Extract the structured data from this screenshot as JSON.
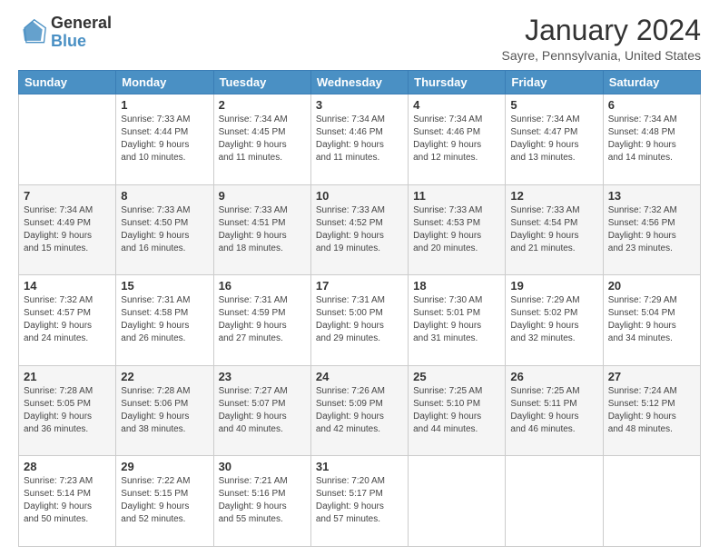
{
  "logo": {
    "line1": "General",
    "line2": "Blue"
  },
  "title": "January 2024",
  "subtitle": "Sayre, Pennsylvania, United States",
  "days_header": [
    "Sunday",
    "Monday",
    "Tuesday",
    "Wednesday",
    "Thursday",
    "Friday",
    "Saturday"
  ],
  "weeks": [
    [
      {
        "day": "",
        "info": ""
      },
      {
        "day": "1",
        "info": "Sunrise: 7:33 AM\nSunset: 4:44 PM\nDaylight: 9 hours\nand 10 minutes."
      },
      {
        "day": "2",
        "info": "Sunrise: 7:34 AM\nSunset: 4:45 PM\nDaylight: 9 hours\nand 11 minutes."
      },
      {
        "day": "3",
        "info": "Sunrise: 7:34 AM\nSunset: 4:46 PM\nDaylight: 9 hours\nand 11 minutes."
      },
      {
        "day": "4",
        "info": "Sunrise: 7:34 AM\nSunset: 4:46 PM\nDaylight: 9 hours\nand 12 minutes."
      },
      {
        "day": "5",
        "info": "Sunrise: 7:34 AM\nSunset: 4:47 PM\nDaylight: 9 hours\nand 13 minutes."
      },
      {
        "day": "6",
        "info": "Sunrise: 7:34 AM\nSunset: 4:48 PM\nDaylight: 9 hours\nand 14 minutes."
      }
    ],
    [
      {
        "day": "7",
        "info": "Sunrise: 7:34 AM\nSunset: 4:49 PM\nDaylight: 9 hours\nand 15 minutes."
      },
      {
        "day": "8",
        "info": "Sunrise: 7:33 AM\nSunset: 4:50 PM\nDaylight: 9 hours\nand 16 minutes."
      },
      {
        "day": "9",
        "info": "Sunrise: 7:33 AM\nSunset: 4:51 PM\nDaylight: 9 hours\nand 18 minutes."
      },
      {
        "day": "10",
        "info": "Sunrise: 7:33 AM\nSunset: 4:52 PM\nDaylight: 9 hours\nand 19 minutes."
      },
      {
        "day": "11",
        "info": "Sunrise: 7:33 AM\nSunset: 4:53 PM\nDaylight: 9 hours\nand 20 minutes."
      },
      {
        "day": "12",
        "info": "Sunrise: 7:33 AM\nSunset: 4:54 PM\nDaylight: 9 hours\nand 21 minutes."
      },
      {
        "day": "13",
        "info": "Sunrise: 7:32 AM\nSunset: 4:56 PM\nDaylight: 9 hours\nand 23 minutes."
      }
    ],
    [
      {
        "day": "14",
        "info": "Sunrise: 7:32 AM\nSunset: 4:57 PM\nDaylight: 9 hours\nand 24 minutes."
      },
      {
        "day": "15",
        "info": "Sunrise: 7:31 AM\nSunset: 4:58 PM\nDaylight: 9 hours\nand 26 minutes."
      },
      {
        "day": "16",
        "info": "Sunrise: 7:31 AM\nSunset: 4:59 PM\nDaylight: 9 hours\nand 27 minutes."
      },
      {
        "day": "17",
        "info": "Sunrise: 7:31 AM\nSunset: 5:00 PM\nDaylight: 9 hours\nand 29 minutes."
      },
      {
        "day": "18",
        "info": "Sunrise: 7:30 AM\nSunset: 5:01 PM\nDaylight: 9 hours\nand 31 minutes."
      },
      {
        "day": "19",
        "info": "Sunrise: 7:29 AM\nSunset: 5:02 PM\nDaylight: 9 hours\nand 32 minutes."
      },
      {
        "day": "20",
        "info": "Sunrise: 7:29 AM\nSunset: 5:04 PM\nDaylight: 9 hours\nand 34 minutes."
      }
    ],
    [
      {
        "day": "21",
        "info": "Sunrise: 7:28 AM\nSunset: 5:05 PM\nDaylight: 9 hours\nand 36 minutes."
      },
      {
        "day": "22",
        "info": "Sunrise: 7:28 AM\nSunset: 5:06 PM\nDaylight: 9 hours\nand 38 minutes."
      },
      {
        "day": "23",
        "info": "Sunrise: 7:27 AM\nSunset: 5:07 PM\nDaylight: 9 hours\nand 40 minutes."
      },
      {
        "day": "24",
        "info": "Sunrise: 7:26 AM\nSunset: 5:09 PM\nDaylight: 9 hours\nand 42 minutes."
      },
      {
        "day": "25",
        "info": "Sunrise: 7:25 AM\nSunset: 5:10 PM\nDaylight: 9 hours\nand 44 minutes."
      },
      {
        "day": "26",
        "info": "Sunrise: 7:25 AM\nSunset: 5:11 PM\nDaylight: 9 hours\nand 46 minutes."
      },
      {
        "day": "27",
        "info": "Sunrise: 7:24 AM\nSunset: 5:12 PM\nDaylight: 9 hours\nand 48 minutes."
      }
    ],
    [
      {
        "day": "28",
        "info": "Sunrise: 7:23 AM\nSunset: 5:14 PM\nDaylight: 9 hours\nand 50 minutes."
      },
      {
        "day": "29",
        "info": "Sunrise: 7:22 AM\nSunset: 5:15 PM\nDaylight: 9 hours\nand 52 minutes."
      },
      {
        "day": "30",
        "info": "Sunrise: 7:21 AM\nSunset: 5:16 PM\nDaylight: 9 hours\nand 55 minutes."
      },
      {
        "day": "31",
        "info": "Sunrise: 7:20 AM\nSunset: 5:17 PM\nDaylight: 9 hours\nand 57 minutes."
      },
      {
        "day": "",
        "info": ""
      },
      {
        "day": "",
        "info": ""
      },
      {
        "day": "",
        "info": ""
      }
    ]
  ]
}
